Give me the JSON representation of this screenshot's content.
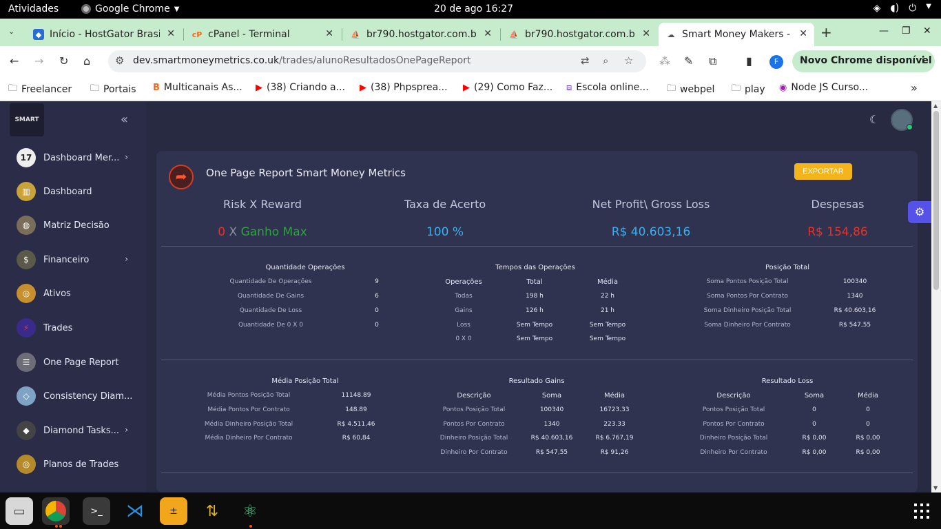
{
  "system": {
    "activities": "Atividades",
    "app_name": "Google Chrome",
    "clock": "20 de ago  16:27"
  },
  "tabs": [
    {
      "title": "Início - HostGator Brasil",
      "favicon": "hostgator-icon"
    },
    {
      "title": "cPanel - Terminal",
      "favicon": "cpanel-icon"
    },
    {
      "title": "br790.hostgator.com.br",
      "favicon": "phpmyadmin-icon"
    },
    {
      "title": "br790.hostgator.com.br",
      "favicon": "phpmyadmin-icon"
    },
    {
      "title": "Smart Money Makers - One Page Report",
      "favicon": "smart-money-icon"
    }
  ],
  "address": {
    "domain": "dev.smartmoneymetrics.co.uk",
    "path": "/trades/alunoResultadosOnePageReport"
  },
  "profile_initial": "F",
  "update_label": "Novo Chrome disponível",
  "bookmarks": [
    {
      "label": "Freelancer",
      "icon": "folder-icon"
    },
    {
      "label": "Portais",
      "icon": "folder-icon"
    },
    {
      "label": "Multicanais As...",
      "icon": "blogger-icon"
    },
    {
      "label": "(38) Criando a...",
      "icon": "youtube-icon"
    },
    {
      "label": "(38) Phpsprea...",
      "icon": "youtube-icon"
    },
    {
      "label": "(29) Como Faz...",
      "icon": "youtube-icon"
    },
    {
      "label": "Escola online...",
      "icon": "school-icon"
    },
    {
      "label": "webpel",
      "icon": "folder-icon"
    },
    {
      "label": "play",
      "icon": "folder-icon"
    },
    {
      "label": "Node JS Curso...",
      "icon": "course-icon"
    }
  ],
  "sidebar": {
    "logo_text": "SMART",
    "items": [
      {
        "label": "Dashboard Mer...",
        "icon": "calendar-17-icon",
        "has_children": true
      },
      {
        "label": "Dashboard",
        "icon": "dashboard-icon",
        "has_children": false
      },
      {
        "label": "Matriz Decisão",
        "icon": "matrix-icon",
        "has_children": false
      },
      {
        "label": "Financeiro",
        "icon": "finance-icon",
        "has_children": true
      },
      {
        "label": "Ativos",
        "icon": "assets-icon",
        "has_children": false
      },
      {
        "label": "Trades",
        "icon": "trades-icon",
        "has_children": false
      },
      {
        "label": "One Page Report",
        "icon": "report-icon",
        "has_children": false
      },
      {
        "label": "Consistency Diam...",
        "icon": "diamond-icon",
        "has_children": false
      },
      {
        "label": "Diamond Tasks...",
        "icon": "diamond-tasks-icon",
        "has_children": true
      },
      {
        "label": "Planos de Trades",
        "icon": "target-icon",
        "has_children": false
      }
    ]
  },
  "report": {
    "title": "One Page Report Smart Money Metrics",
    "export_label": "EXPORTAR",
    "kpis": [
      {
        "label": "Risk X Reward",
        "value_a": "0",
        "sep": " X ",
        "value_b": "Ganho Max"
      },
      {
        "label": "Taxa de Acerto",
        "value": "100 %"
      },
      {
        "label": "Net Profit\\ Gross Loss",
        "value": "R$ 40.603,16"
      },
      {
        "label": "Despesas",
        "value": "R$ 154,86"
      }
    ],
    "quantidade": {
      "title": "Quantidade Operações",
      "rows": [
        [
          "Quantidade De Operações",
          "9"
        ],
        [
          "Quantidade De Gains",
          "6"
        ],
        [
          "Quantidade De Loss",
          "0"
        ],
        [
          "Quantidade De 0 X 0",
          "0"
        ]
      ]
    },
    "tempos": {
      "title": "Tempos das Operações",
      "headers": [
        "Operações",
        "Total",
        "Média"
      ],
      "rows": [
        [
          "Todas",
          "198 h",
          "22 h"
        ],
        [
          "Gains",
          "126 h",
          "21 h"
        ],
        [
          "Loss",
          "Sem Tempo",
          "Sem Tempo"
        ],
        [
          "0 X 0",
          "Sem Tempo",
          "Sem Tempo"
        ]
      ]
    },
    "posicao": {
      "title": "Posição Total",
      "rows": [
        [
          "Soma Pontos Posição Total",
          "100340"
        ],
        [
          "Soma Pontos Por Contrato",
          "1340"
        ],
        [
          "Soma Dinheiro Posição Total",
          "R$ 40.603,16"
        ],
        [
          "Soma Dinheiro Por Contrato",
          "R$ 547,55"
        ]
      ]
    },
    "media": {
      "title": "Média Posição Total",
      "rows": [
        [
          "Média Pontos Posição Total",
          "11148.89"
        ],
        [
          "Média Pontos Por Contrato",
          "148.89"
        ],
        [
          "Média Dinheiro Posição Total",
          "R$ 4.511,46"
        ],
        [
          "Média Dinheiro Por Contrato",
          "R$ 60,84"
        ]
      ]
    },
    "gains": {
      "title": "Resultado Gains",
      "headers": [
        "Descrição",
        "Soma",
        "Média"
      ],
      "rows": [
        [
          "Pontos Posição Total",
          "100340",
          "16723.33"
        ],
        [
          "Pontos Por Contrato",
          "1340",
          "223.33"
        ],
        [
          "Dinheiro Posição Total",
          "R$ 40.603,16",
          "R$ 6.767,19"
        ],
        [
          "Dinheiro Por Contrato",
          "R$ 547,55",
          "R$ 91,26"
        ]
      ]
    },
    "loss": {
      "title": "Resultado Loss",
      "headers": [
        "Descrição",
        "Soma",
        "Média"
      ],
      "rows": [
        [
          "Pontos Posição Total",
          "0",
          "0"
        ],
        [
          "Pontos Por Contrato",
          "0",
          "0"
        ],
        [
          "Dinheiro Posição Total",
          "R$ 0,00",
          "R$ 0,00"
        ],
        [
          "Dinheiro Por Contrato",
          "R$ 0,00",
          "R$ 0,00"
        ]
      ]
    }
  },
  "colors": {
    "red": "#e8312a",
    "green": "#2aa53a",
    "blue": "#3ab0f0",
    "export": "#f5b419",
    "bg": "#282a42",
    "card": "#30334f"
  },
  "taskbar": [
    "files-icon",
    "chrome-icon",
    "terminal-icon",
    "vscode-icon",
    "calculator-icon",
    "filezilla-icon",
    "atom-icon",
    "app-grid-icon"
  ]
}
